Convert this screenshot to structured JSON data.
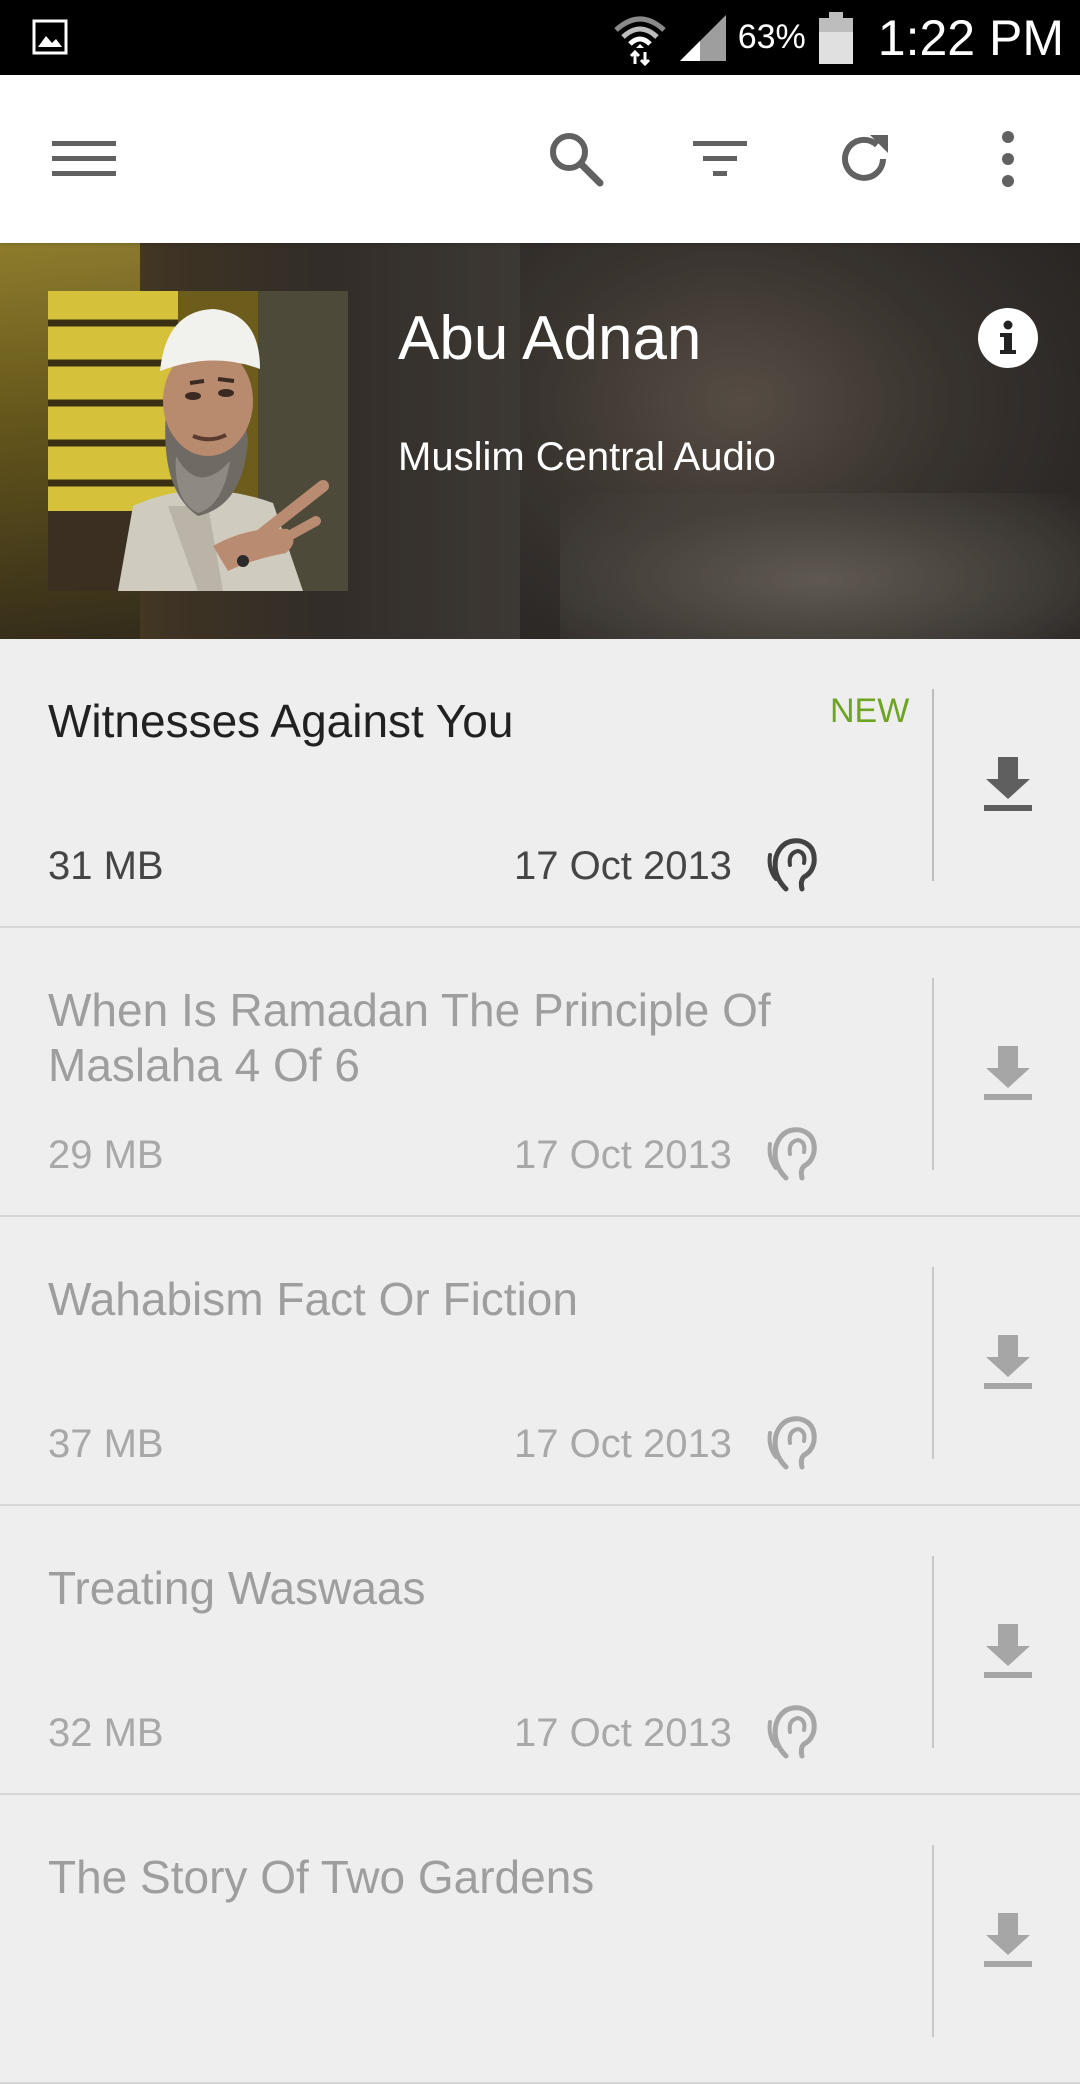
{
  "status_bar": {
    "battery": "63%",
    "time": "1:22 PM",
    "icons": [
      "image-icon",
      "wifi-icon",
      "signal-icon",
      "battery-icon"
    ]
  },
  "toolbar": {
    "icons": [
      "menu-icon",
      "search-icon",
      "filter-icon",
      "refresh-icon",
      "more-vert-icon"
    ]
  },
  "header": {
    "name": "Abu Adnan",
    "subtitle": "Muslim Central Audio",
    "info_icon": "info-icon"
  },
  "episodes": [
    {
      "title": "Witnesses Against You",
      "size": "31 MB",
      "date": "17 Oct 2013",
      "badge": "NEW",
      "active": true
    },
    {
      "title": "When Is Ramadan The Principle Of Maslaha 4 Of 6",
      "size": "29 MB",
      "date": "17 Oct 2013",
      "badge": "",
      "active": false
    },
    {
      "title": "Wahabism Fact Or Fiction",
      "size": "37 MB",
      "date": "17 Oct 2013",
      "badge": "",
      "active": false
    },
    {
      "title": "Treating Waswaas",
      "size": "32 MB",
      "date": "17 Oct 2013",
      "badge": "",
      "active": false
    },
    {
      "title": "The Story Of Two Gardens",
      "size": "",
      "date": "",
      "badge": "",
      "active": false
    }
  ],
  "colors": {
    "new_badge": "#6ea423",
    "toolbar_icon": "#616161",
    "list_background": "#eeeeee"
  }
}
